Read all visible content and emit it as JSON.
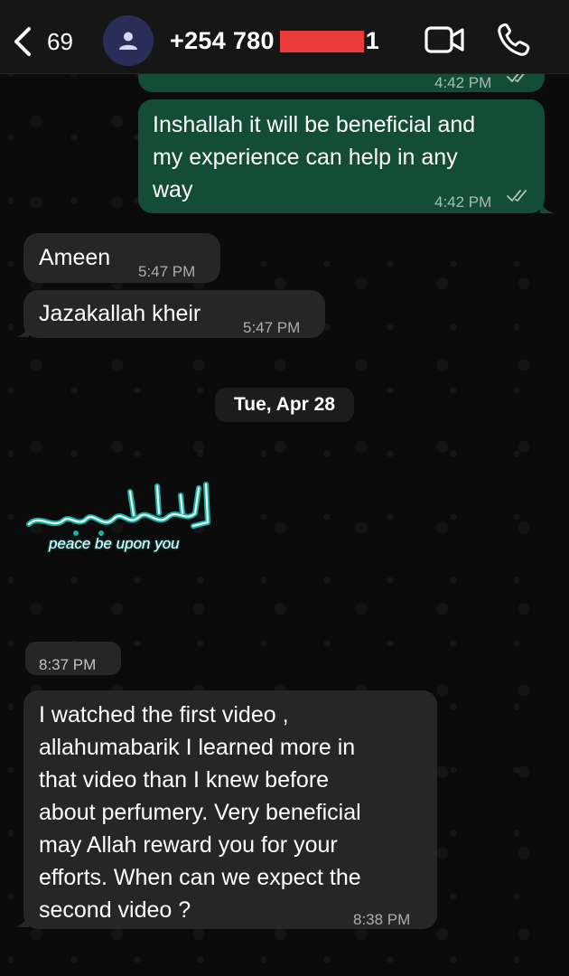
{
  "header": {
    "back_count": "69",
    "phone_prefix": "+254 780",
    "phone_suffix": "1"
  },
  "messages": {
    "partial_time": "4:42 PM",
    "m1": {
      "text": "Inshallah it will be beneficial and\nmy experience can help in any\nway",
      "time": "4:42 PM"
    },
    "m2": {
      "text": "Ameen",
      "time": "5:47 PM"
    },
    "m3": {
      "text": "Jazakallah kheir",
      "time": "5:47 PM"
    },
    "date_separator": "Tue, Apr 28",
    "sticker_caption": "peace be upon you",
    "sticker_time": "8:37 PM",
    "m5": {
      "text": "I watched the first video ,\nallahumabarik I learned more in\nthat video than I knew before\nabout perfumery. Very beneficial\nmay Allah reward you for your\nefforts. When can we expect the\nsecond video ?",
      "time": "8:38 PM"
    }
  },
  "colors": {
    "outgoing_bubble": "#144d37",
    "incoming_bubble": "#262626",
    "header_bg": "#161616",
    "avatar_bg": "#2b2d59",
    "redaction": "#ec3b3b",
    "sticker_teal": "#17b3a8"
  },
  "icons": [
    "chevron-left-icon",
    "person-icon",
    "video-camera-icon",
    "phone-icon",
    "double-check-icon"
  ]
}
